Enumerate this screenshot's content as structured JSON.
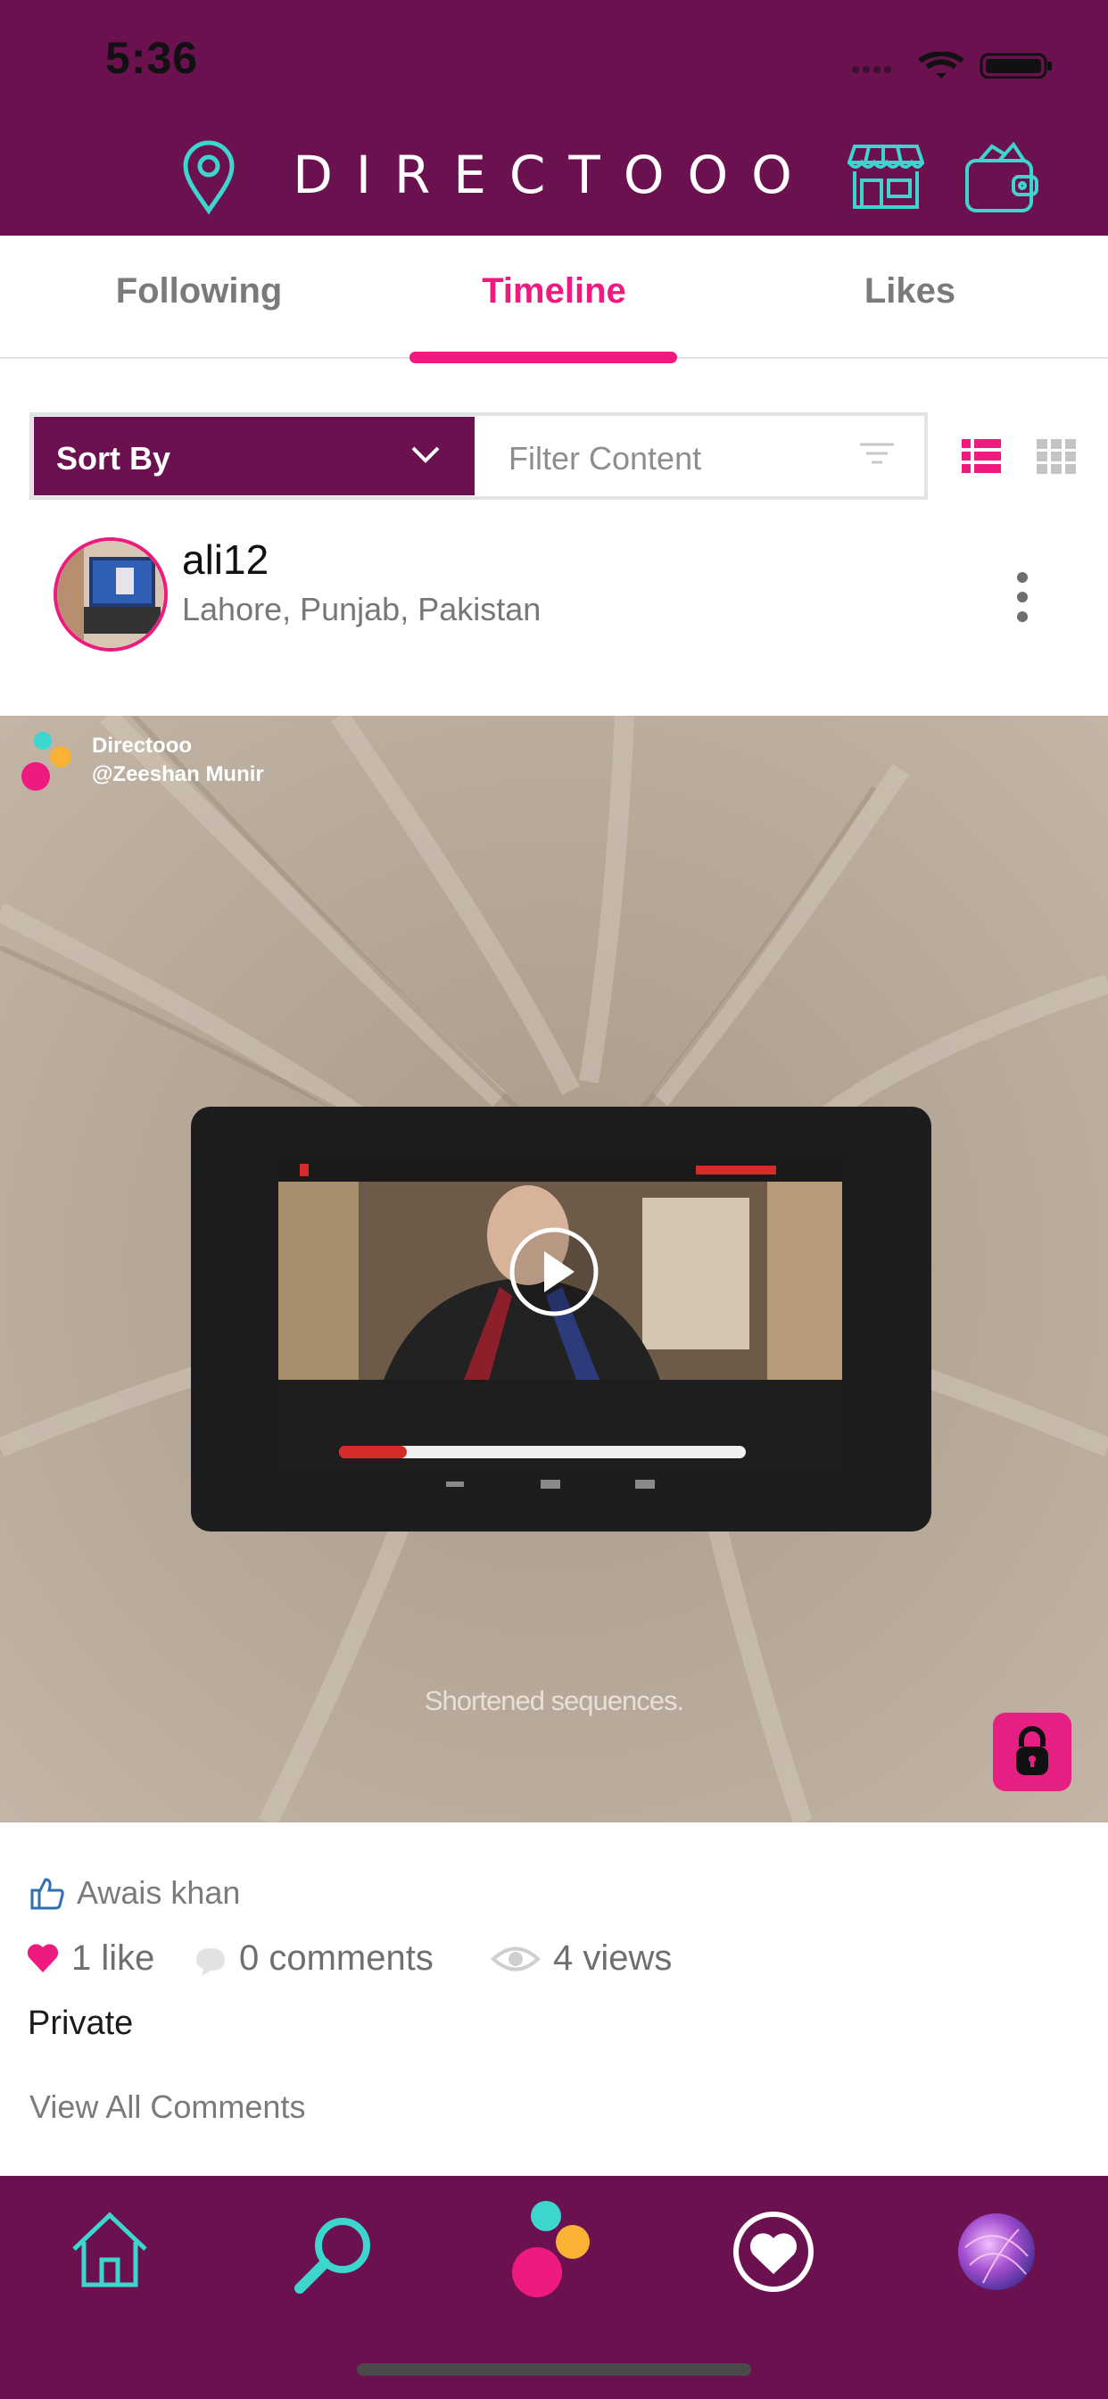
{
  "status_bar": {
    "time": "5:36"
  },
  "header": {
    "title": "DIRECTOOO",
    "location_icon": "map-pin-icon",
    "store_icon": "store-icon",
    "wallet_icon": "wallet-icon"
  },
  "tabs": [
    {
      "label": "Following",
      "active": false
    },
    {
      "label": "Timeline",
      "active": true
    },
    {
      "label": "Likes",
      "active": false
    }
  ],
  "toolbar": {
    "sort_label": "Sort By",
    "filter_placeholder": "Filter Content",
    "view_modes": [
      "list",
      "grid"
    ]
  },
  "post": {
    "username": "ali12",
    "location": "Lahore, Punjab, Pakistan",
    "watermark_brand": "Directooo",
    "watermark_handle": "@Zeeshan Munir",
    "caption": "Shortened sequences.",
    "liked_by": "Awais khan",
    "likes": "1 like",
    "comments": "0 comments",
    "views": "4 views",
    "privacy": "Private",
    "view_all_comments": "View All Comments"
  },
  "bottom_nav": [
    "home-icon",
    "search-icon",
    "create-icon",
    "favorites-icon",
    "profile-avatar"
  ],
  "colors": {
    "brand": "#6c1150",
    "accent": "#ee1a7e",
    "teal": "#3dd6cf",
    "yellow": "#f9b234"
  }
}
